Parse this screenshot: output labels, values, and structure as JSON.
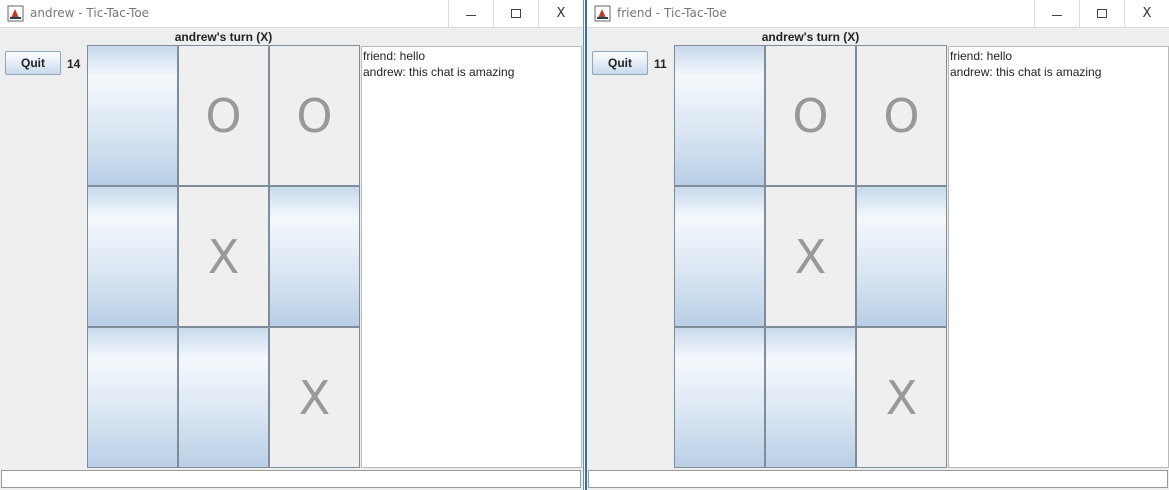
{
  "windows": [
    {
      "title": "andrew - Tic-Tac-Toe",
      "quit_label": "Quit",
      "counter": "14",
      "turn_text": "andrew's turn (X)",
      "board": [
        "",
        "O",
        "O",
        "",
        "X",
        "",
        "",
        "",
        "X"
      ],
      "chat": [
        "friend: hello",
        "andrew: this chat is amazing"
      ],
      "chat_input": ""
    },
    {
      "title": "friend - Tic-Tac-Toe",
      "quit_label": "Quit",
      "counter": "11",
      "turn_text": "andrew's turn (X)",
      "board": [
        "",
        "O",
        "O",
        "",
        "X",
        "",
        "",
        "",
        "X"
      ],
      "chat": [
        "friend: hello",
        "andrew: this chat is amazing"
      ],
      "chat_input": ""
    }
  ],
  "titlebar_controls": {
    "minimize_icon": "minimize-icon",
    "maximize_icon": "maximize-icon",
    "close_glyph": "X"
  },
  "colors": {
    "empty_cell": "#c7d9ec",
    "mark_text": "#999999",
    "active_border": "#2f6fb4"
  }
}
